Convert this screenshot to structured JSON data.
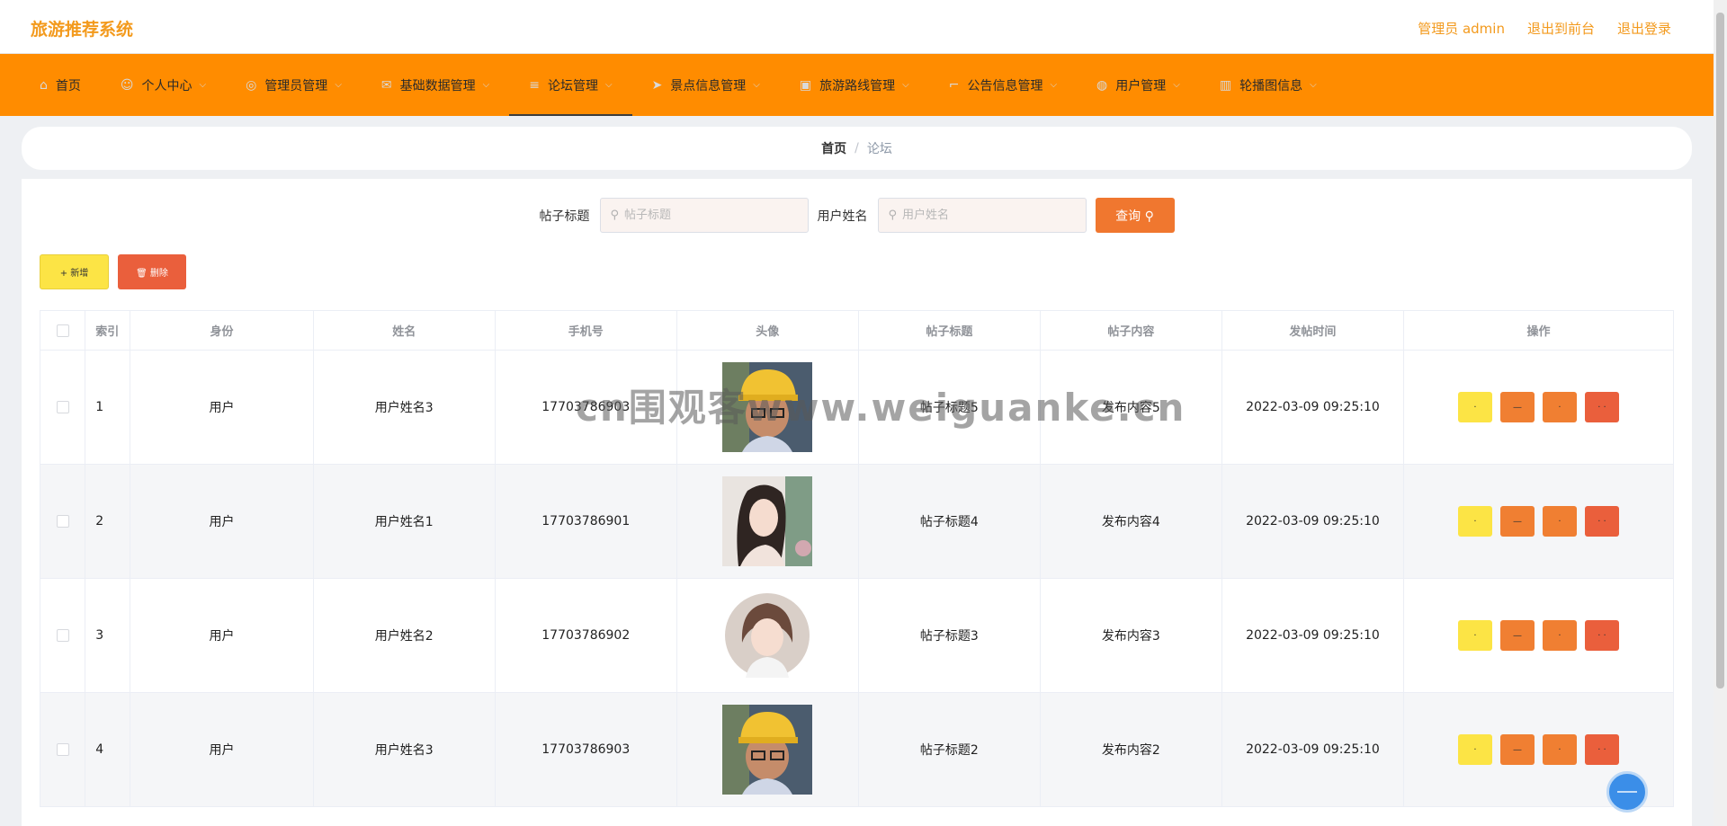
{
  "app": {
    "title": "旅游推荐系统"
  },
  "top_links": [
    "管理员 admin",
    "退出到前台",
    "退出登录"
  ],
  "nav": [
    {
      "label": "首页",
      "icon": "home-icon",
      "glyph": "⌂",
      "chevron": false,
      "active": false
    },
    {
      "label": "个人中心",
      "icon": "user-icon",
      "glyph": "☺",
      "chevron": true,
      "active": false
    },
    {
      "label": "管理员管理",
      "icon": "compass-icon",
      "glyph": "◎",
      "chevron": true,
      "active": false
    },
    {
      "label": "基础数据管理",
      "icon": "mail-icon",
      "glyph": "✉",
      "chevron": true,
      "active": false
    },
    {
      "label": "论坛管理",
      "icon": "list-icon",
      "glyph": "≡",
      "chevron": true,
      "active": true
    },
    {
      "label": "景点信息管理",
      "icon": "send-icon",
      "glyph": "➤",
      "chevron": true,
      "active": false
    },
    {
      "label": "旅游路线管理",
      "icon": "suitcase-icon",
      "glyph": "▣",
      "chevron": true,
      "active": false
    },
    {
      "label": "公告信息管理",
      "icon": "crop-icon",
      "glyph": "⌐",
      "chevron": true,
      "active": false
    },
    {
      "label": "用户管理",
      "icon": "help-icon",
      "glyph": "◍",
      "chevron": true,
      "active": false
    },
    {
      "label": "轮播图信息",
      "icon": "grid-icon",
      "glyph": "▥",
      "chevron": true,
      "active": false
    }
  ],
  "breadcrumb": {
    "home": "首页",
    "separator": "/",
    "current": "论坛"
  },
  "search": {
    "title_label": "帖子标题",
    "title_placeholder": "帖子标题",
    "name_label": "用户姓名",
    "name_placeholder": "用户姓名",
    "query_label": "查询 ⚲"
  },
  "actions": {
    "add_label": "+ 新增",
    "delete_label": "🗑 删除"
  },
  "table": {
    "columns": [
      "",
      "索引",
      "身份",
      "姓名",
      "手机号",
      "头像",
      "帖子标题",
      "帖子内容",
      "发帖时间",
      "操作"
    ],
    "rows": [
      {
        "index": "1",
        "role": "用户",
        "name": "用户姓名3",
        "phone": "17703786903",
        "avatar": "avatar-boy-yellow-hat",
        "title": "帖子标题5",
        "content": "发布内容5",
        "time": "2022-03-09 09:25:10"
      },
      {
        "index": "2",
        "role": "用户",
        "name": "用户姓名1",
        "phone": "17703786901",
        "avatar": "avatar-girl-long-hair",
        "title": "帖子标题4",
        "content": "发布内容4",
        "time": "2022-03-09 09:25:10"
      },
      {
        "index": "3",
        "role": "用户",
        "name": "用户姓名2",
        "phone": "17703786902",
        "avatar": "avatar-girl-short-hair",
        "title": "帖子标题3",
        "content": "发布内容3",
        "time": "2022-03-09 09:25:10"
      },
      {
        "index": "4",
        "role": "用户",
        "name": "用户姓名3",
        "phone": "17703786903",
        "avatar": "avatar-boy-yellow-hat",
        "title": "帖子标题2",
        "content": "发布内容2",
        "time": "2022-03-09 09:25:10"
      }
    ],
    "op_labels": [
      "·",
      "—",
      "·",
      "· ·"
    ]
  },
  "watermark": "cn围观客www.weiguanke.cn",
  "colors": {
    "brand": "#f39a1d",
    "nav_bg": "#ff8c00",
    "query": "#f0772f",
    "add": "#fce445",
    "delete": "#ea5f3c"
  }
}
